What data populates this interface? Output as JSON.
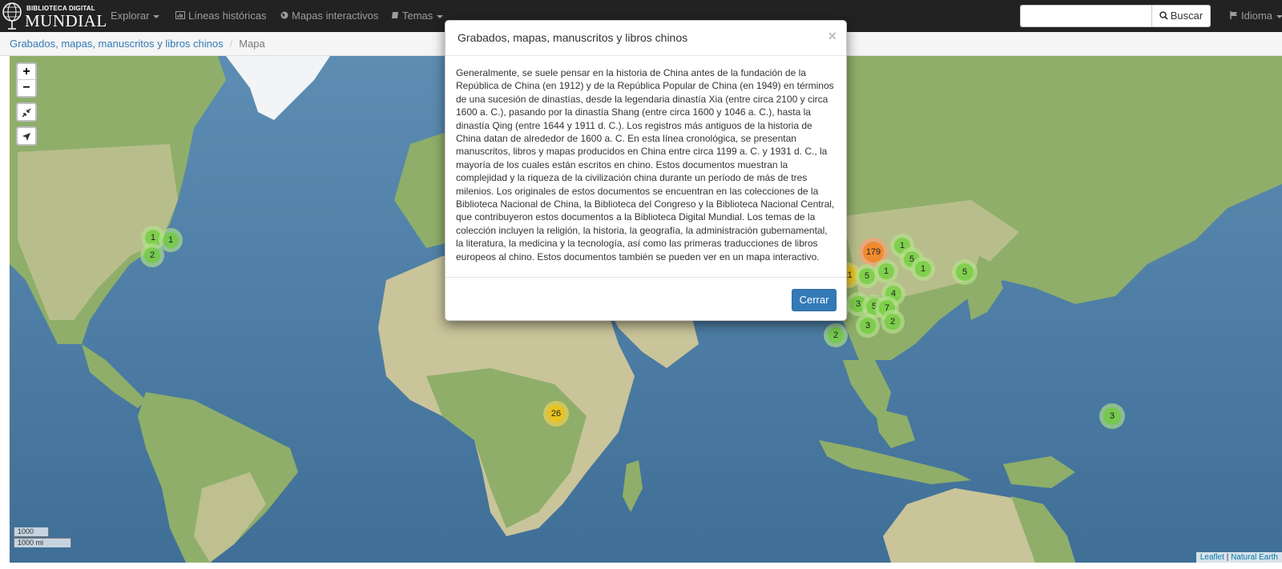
{
  "brand": {
    "small": "BIBLIOTECA DIGITAL",
    "big": "MUNDIAL",
    "logo_icon": "globe-icon"
  },
  "nav": {
    "explorar": "Explorar",
    "lineas": "Líneas históricas",
    "mapas": "Mapas interactivos",
    "temas": "Temas",
    "idioma": "Idioma"
  },
  "search": {
    "placeholder": "",
    "value": "",
    "button_label": "Buscar"
  },
  "breadcrumb": {
    "items": [
      "Grabados, mapas, manuscritos y libros chinos",
      "Mapa"
    ],
    "separator": "/"
  },
  "map": {
    "zoom_in": "+",
    "zoom_out": "−",
    "scale_km": "1000 km",
    "scale_mi": "1000 mi",
    "attribution_leaflet": "Leaflet",
    "attribution_sep": "|",
    "attribution_ne": "Natural Earth",
    "clusters": [
      "1",
      "1",
      "2",
      "26",
      "3",
      "179",
      "1",
      "5",
      "1",
      "11",
      "5",
      "1",
      "4",
      "2",
      "3",
      "5",
      "7",
      "3",
      "2",
      "2",
      "5",
      "3"
    ],
    "colors": {
      "water": "#4f7fa6",
      "land": "#c9c49a",
      "forest": "#8fae6a",
      "ice": "#f2f4f5"
    }
  },
  "modal": {
    "title": "Grabados, mapas, manuscritos y libros chinos",
    "close": "×",
    "body": "Generalmente, se suele pensar en la historia de China antes de la fundación de la República de China (en 1912) y de la República Popular de China (en 1949) en términos de una sucesión de dinastías, desde la legendaria dinastía Xia (entre circa 2100 y circa 1600 a. C.), pasando por la dinastía Shang (entre circa 1600 y 1046 a. C.), hasta la dinastía Qing (entre 1644 y 1911 d. C.). Los registros más antiguos de la historia de China datan de alrededor de 1600 a. C. En esta línea cronológica, se presentan manuscritos, libros y mapas producidos en China entre circa 1199 a. C. y 1931 d. C., la mayoría de los cuales están escritos en chino. Estos documentos muestran la complejidad y la riqueza de la civilización china durante un período de más de tres milenios. Los originales de estos documentos se encuentran en las colecciones de la Biblioteca Nacional de China, la Biblioteca del Congreso y la Biblioteca Nacional Central, que contribuyeron estos documentos a la Biblioteca Digital Mundial. Los temas de la colección incluyen la religión, la historia, la geografía, la administración gubernamental, la literatura, la medicina y la tecnología, así como las primeras traducciones de libros europeos al chino. Estos documentos también se pueden ver en un mapa interactivo.",
    "close_button": "Cerrar"
  }
}
